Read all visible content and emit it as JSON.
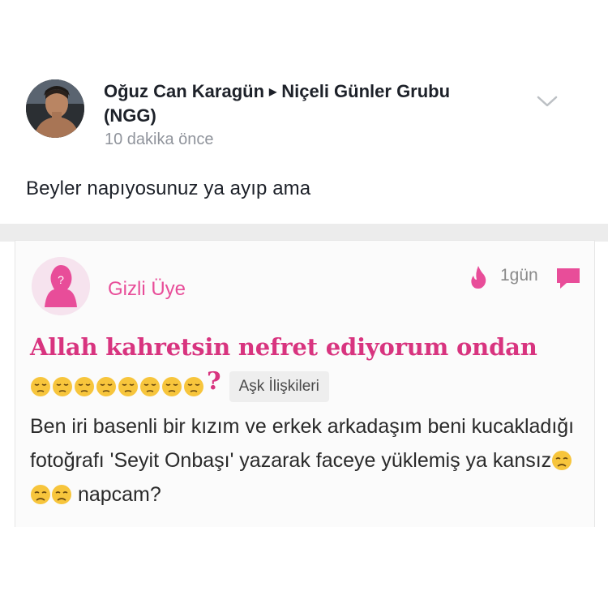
{
  "post": {
    "author": "Oğuz Can Karagün",
    "group": "Niçeli Günler Grubu (NGG)",
    "time": "10 dakika önce",
    "text": "Beyler napıyosunuz ya ayıp ama"
  },
  "shared": {
    "user": "Gizli Üye",
    "age": "1gün",
    "title": "Allah kahretsin nefret ediyorum ondan",
    "title_qmark": "?",
    "tag": "Aşk İlişkileri",
    "body_text_a": "Ben iri basenli bir kızım ve erkek arkadaşım beni kucakladığı fotoğrafı 'Seyit Onbaşı' yazarak faceye yüklemiş ya kansız",
    "body_text_b": " napcam?"
  },
  "colors": {
    "accent": "#e84d99",
    "title": "#d8347f",
    "meta": "#90949c"
  },
  "icons": [
    "caret-right-icon",
    "chevron-down-icon",
    "anonymous-avatar-icon",
    "flame-icon",
    "comment-icon",
    "pensive-face-emoji",
    "disappointed-face-emoji"
  ]
}
